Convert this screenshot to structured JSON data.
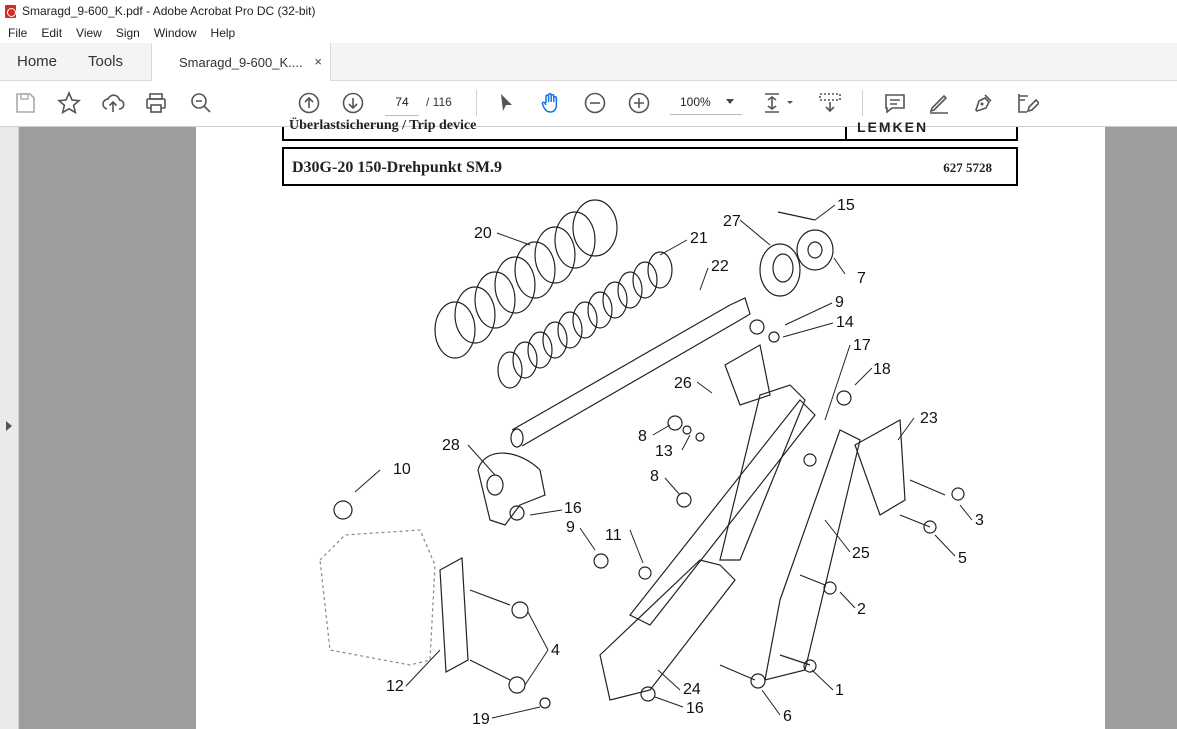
{
  "window": {
    "title": "Smaragd_9-600_K.pdf - Adobe Acrobat Pro DC (32-bit)"
  },
  "menu": [
    "File",
    "Edit",
    "View",
    "Sign",
    "Window",
    "Help"
  ],
  "tabs": {
    "home": "Home",
    "tools": "Tools",
    "document": "Smaragd_9-600_K....",
    "close": "×"
  },
  "toolbar": {
    "page_current": "74",
    "page_total": "/  116",
    "zoom": "100%"
  },
  "document": {
    "header_top": "Überlastsicherung / Trip device",
    "header_logo": "LEMKEN",
    "part_title": "D30G-20 150-Drehpunkt SM.9",
    "part_number": "627 5728",
    "callouts": [
      "15",
      "27",
      "7",
      "20",
      "21",
      "22",
      "9",
      "14",
      "17",
      "18",
      "26",
      "23",
      "8",
      "13",
      "28",
      "8",
      "10",
      "16",
      "3",
      "9",
      "11",
      "5",
      "25",
      "2",
      "4",
      "12",
      "24",
      "1",
      "16",
      "6",
      "19"
    ]
  }
}
